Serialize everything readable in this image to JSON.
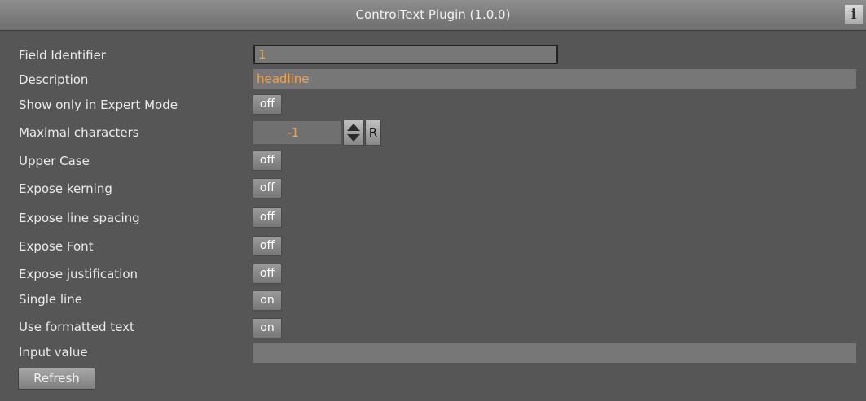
{
  "window": {
    "title": "ControlText Plugin (1.0.0)",
    "info_icon_glyph": "i"
  },
  "rows": {
    "field_identifier": {
      "label": "Field Identifier",
      "value": "1"
    },
    "description": {
      "label": "Description",
      "value": "headline"
    },
    "show_expert": {
      "label": "Show only in Expert Mode",
      "value": "off"
    },
    "max_chars": {
      "label": "Maximal characters",
      "value": "-1",
      "reset_label": "R"
    },
    "upper_case": {
      "label": "Upper Case",
      "value": "off"
    },
    "expose_kerning": {
      "label": "Expose kerning",
      "value": "off"
    },
    "expose_line_spacing": {
      "label": "Expose line spacing",
      "value": "off"
    },
    "expose_font": {
      "label": "Expose Font",
      "value": "off"
    },
    "expose_justification": {
      "label": "Expose justification",
      "value": "off"
    },
    "single_line": {
      "label": "Single line",
      "value": "on"
    },
    "use_formatted_text": {
      "label": "Use formatted text",
      "value": "on"
    },
    "input_value": {
      "label": "Input value",
      "value": ""
    }
  },
  "refresh_label": "Refresh",
  "colors": {
    "background": "#565656",
    "value_text": "#f4a24a",
    "field_bg": "#777777"
  }
}
